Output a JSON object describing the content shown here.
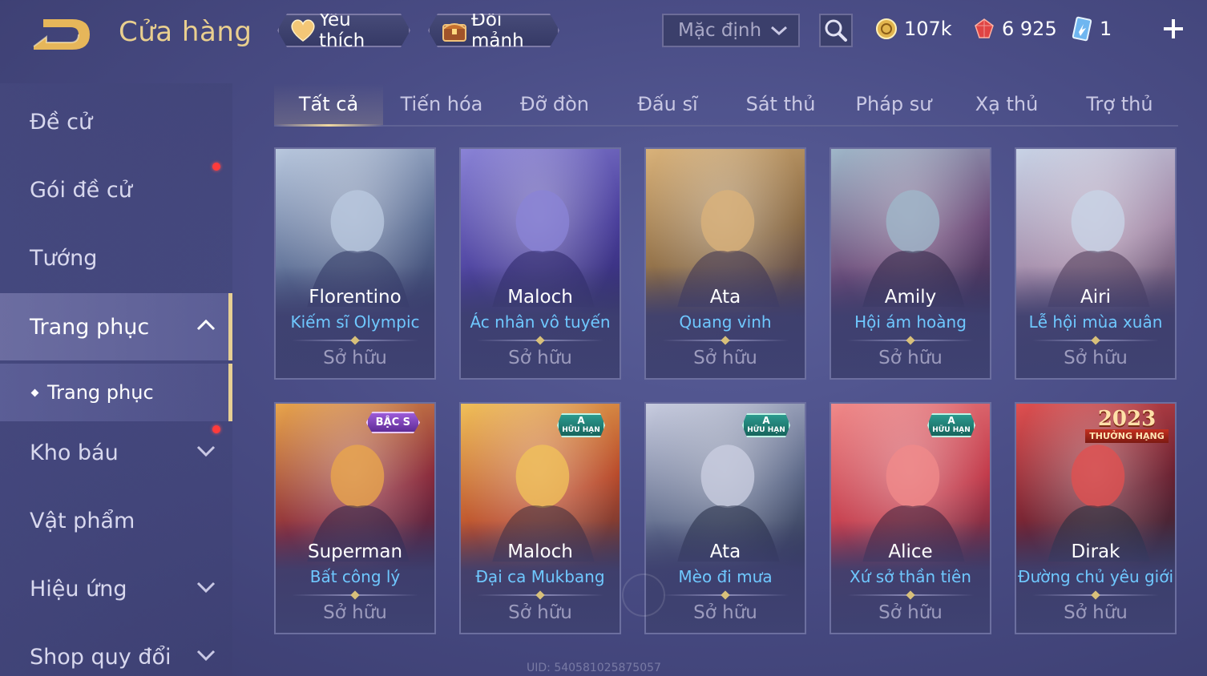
{
  "header": {
    "title": "Cửa hàng",
    "favorite_label": "Yêu thích",
    "exchange_label": "Đổi mảnh",
    "sort_value": "Mặc định",
    "gold": "107k",
    "gems": "6 925",
    "tickets": "1"
  },
  "sidebar": {
    "items": [
      {
        "label": "Đề cử"
      },
      {
        "label": "Gói đề cử"
      },
      {
        "label": "Tướng"
      },
      {
        "label": "Trang phục"
      },
      {
        "label": "Kho báu"
      },
      {
        "label": "Vật phẩm"
      },
      {
        "label": "Hiệu ứng"
      },
      {
        "label": "Shop quy đổi"
      }
    ],
    "sub_item": "Trang phục"
  },
  "tabs": [
    "Tất cả",
    "Tiến hóa",
    "Đỡ đòn",
    "Đấu sĩ",
    "Sát thủ",
    "Pháp sư",
    "Xạ thủ",
    "Trợ thủ"
  ],
  "cards": [
    {
      "hero": "Florentino",
      "skin": "Kiếm sĩ Olympic",
      "status": "Sở hữu",
      "colors": [
        "#b9c8de",
        "#5a6c93",
        "#2d3461"
      ]
    },
    {
      "hero": "Maloch",
      "skin": "Ác nhân vô tuyến",
      "status": "Sở hữu",
      "colors": [
        "#8a83d6",
        "#4a3f9c",
        "#2a2466"
      ]
    },
    {
      "hero": "Ata",
      "skin": "Quang vinh",
      "status": "Sở hữu",
      "colors": [
        "#d9b27a",
        "#8a6a44",
        "#3b3150"
      ]
    },
    {
      "hero": "Amily",
      "skin": "Hội ám hoàng",
      "status": "Sở hữu",
      "colors": [
        "#9fb7c9",
        "#6c4a78",
        "#2c2244"
      ]
    },
    {
      "hero": "Airi",
      "skin": "Lễ hội mùa xuân",
      "status": "Sở hữu",
      "colors": [
        "#c8d3e6",
        "#a48aa8",
        "#4a3654"
      ]
    },
    {
      "hero": "Superman",
      "skin": "Bất công lý",
      "status": "Sở hữu",
      "badge_type": "rank",
      "badge": "BẬC S",
      "colors": [
        "#e8a54c",
        "#8a2a3a",
        "#2a2046"
      ]
    },
    {
      "hero": "Maloch",
      "skin": "Đại ca Mukbang",
      "status": "Sở hữu",
      "badge_type": "limited",
      "badge": "A",
      "badge_sub": "HỮU HẠN",
      "colors": [
        "#f0c05a",
        "#b94a2a",
        "#3a2a3a"
      ]
    },
    {
      "hero": "Ata",
      "skin": "Mèo đi mưa",
      "status": "Sở hữu",
      "badge_type": "limited",
      "badge": "A",
      "badge_sub": "HỮU HẠN",
      "colors": [
        "#c9cde0",
        "#5c6888",
        "#232a44"
      ]
    },
    {
      "hero": "Alice",
      "skin": "Xứ sở thần tiên",
      "status": "Sở hữu",
      "badge_type": "limited",
      "badge": "A",
      "badge_sub": "HỮU HẠN",
      "colors": [
        "#f08a8a",
        "#c23a4a",
        "#3a1f3a"
      ]
    },
    {
      "hero": "Dirak",
      "skin": "Đường chủ yêu giới",
      "status": "Sở hữu",
      "badge_type": "year",
      "badge": "2023",
      "badge_sub": "THƯỞNG HẠNG",
      "colors": [
        "#e05050",
        "#6a2030",
        "#1f2c3c"
      ]
    }
  ],
  "uid": "UID: 540581025875057"
}
